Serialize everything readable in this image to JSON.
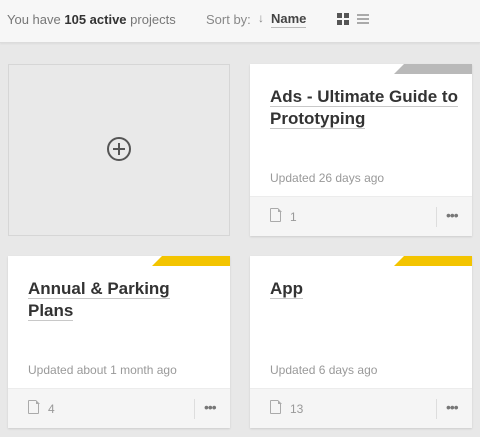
{
  "header": {
    "summary_prefix": "You have",
    "summary_count": "105 active",
    "summary_suffix": "projects",
    "sort_label": "Sort by:",
    "sort_arrow": "↓",
    "sort_value": "Name",
    "view_modes": [
      "grid-view-icon",
      "list-view-icon"
    ],
    "active_view": "grid"
  },
  "new_project": {
    "icon": "plus-circle-icon"
  },
  "projects": [
    {
      "title": "Ads - Ultimate Guide to Prototyping",
      "updated": "Updated 26 days ago",
      "pages": "1",
      "ribbon_color": "#b9b9b9"
    },
    {
      "title": "Annual & Parking Plans",
      "updated": "Updated about 1 month ago",
      "pages": "4",
      "ribbon_color": "#f3c400"
    },
    {
      "title": "App",
      "updated": "Updated 6 days ago",
      "pages": "13",
      "ribbon_color": "#f3c400"
    }
  ],
  "more_label": "•••"
}
